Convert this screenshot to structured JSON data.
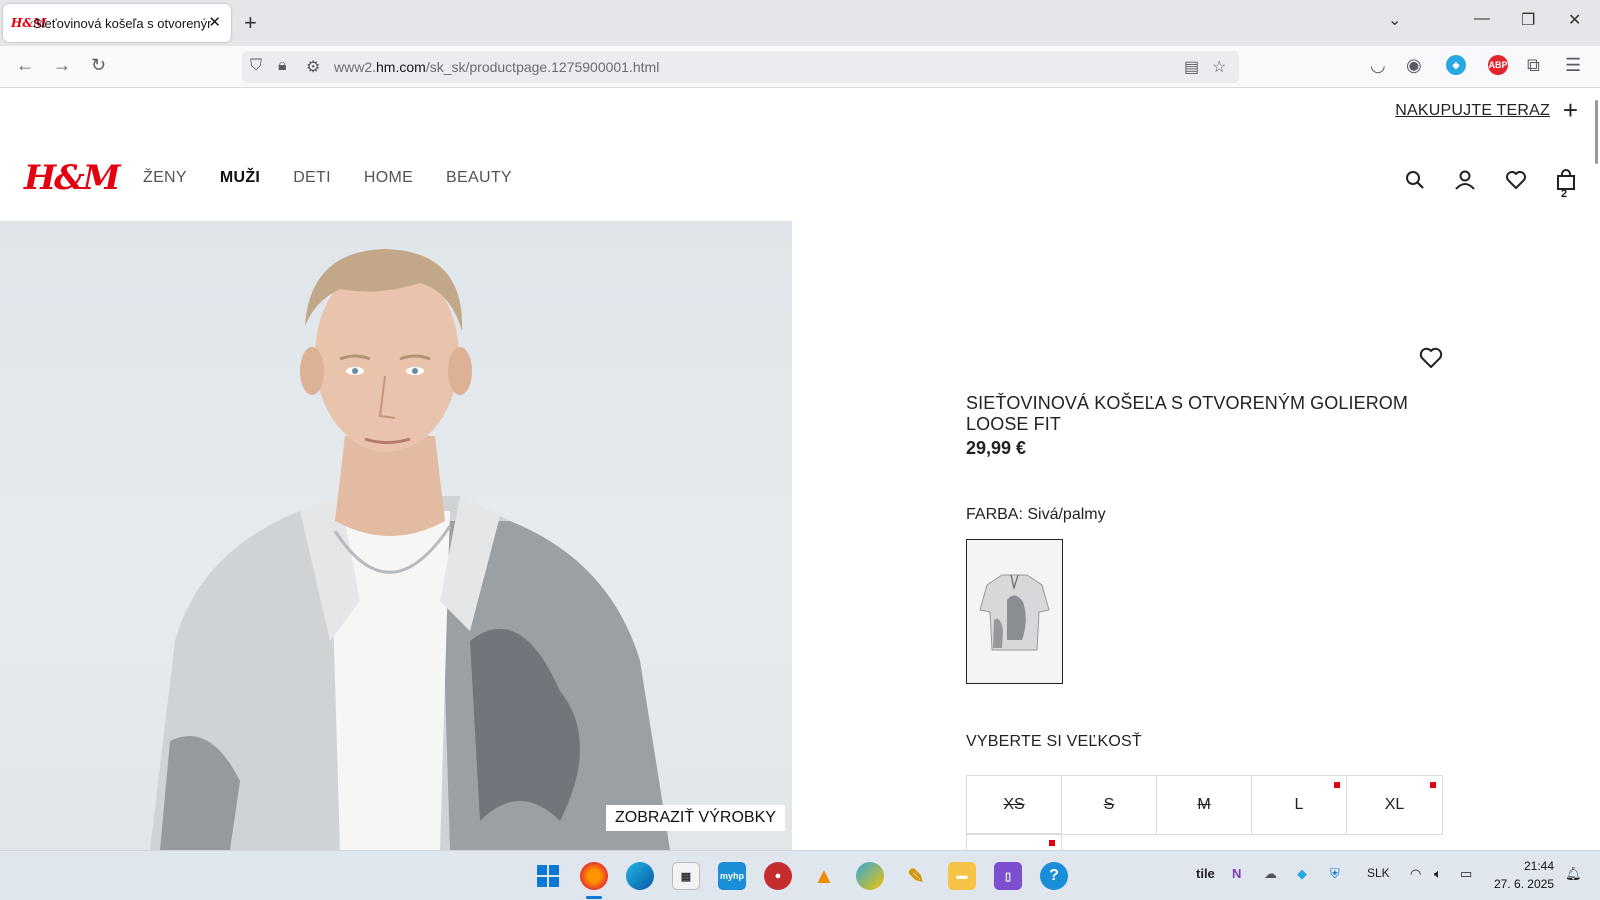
{
  "browser": {
    "tab_title": "Sieťovinová košeľa s otvoreným",
    "tab_favicon": "H&M",
    "url_prefix": "www2.",
    "url_domain": "hm.com",
    "url_path": "/sk_sk/productpage.1275900001.html"
  },
  "header": {
    "shop_now": "NAKUPUJTE TERAZ",
    "logo": "H&M",
    "nav": [
      "ŽENY",
      "MUŽI",
      "DETI",
      "HOME",
      "BEAUTY"
    ],
    "active_nav": "MUŽI",
    "cart_count": "2"
  },
  "product": {
    "name": "SIEŤOVINOVÁ KOŠEĽA S OTVORENÝM GOLIEROM LOOSE FIT",
    "price": "29,99 €",
    "color_label": "FARBA: Sivá/palmy",
    "size_label": "VYBERTE SI VEĽKOSŤ",
    "sizes": [
      {
        "label": "XS",
        "available": false,
        "few_left": false
      },
      {
        "label": "S",
        "available": false,
        "few_left": false
      },
      {
        "label": "M",
        "available": false,
        "few_left": false
      },
      {
        "label": "L",
        "available": true,
        "few_left": true
      },
      {
        "label": "XL",
        "available": true,
        "few_left": true
      }
    ],
    "show_products": "ZOBRAZIŤ VÝROBKY"
  },
  "taskbar": {
    "lang": "SLK",
    "time": "21:44",
    "date": "27. 6. 2025",
    "tray_label": "tile"
  },
  "colors": {
    "brand_red": "#e50010",
    "text": "#222222"
  }
}
